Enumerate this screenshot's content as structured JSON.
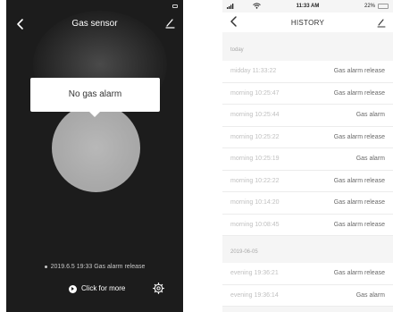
{
  "left": {
    "title": "Gas sensor",
    "status_popup": "No gas alarm",
    "last_event": "2019.6.5 19:33 Gas alarm release",
    "more_label": "Click for more",
    "icons": {
      "back": "chevron-left-icon",
      "edit": "pencil-icon",
      "more": "play-circle-icon",
      "settings": "gear-icon"
    }
  },
  "right": {
    "status_bar": {
      "time": "11:33 AM",
      "battery": "22%"
    },
    "title": "HISTORY",
    "sections": [
      {
        "label": "today",
        "rows": [
          {
            "time": "midday  11:33:22",
            "event": "Gas alarm release"
          },
          {
            "time": "morning  10:25:47",
            "event": "Gas alarm release"
          },
          {
            "time": "morning  10:25:44",
            "event": "Gas alarm"
          },
          {
            "time": "morning  10:25:22",
            "event": "Gas alarm release"
          },
          {
            "time": "morning  10:25:19",
            "event": "Gas alarm"
          },
          {
            "time": "morning  10:22:22",
            "event": "Gas alarm release"
          },
          {
            "time": "morning  10:14:20",
            "event": "Gas alarm release"
          },
          {
            "time": "morning  10:08:45",
            "event": "Gas alarm release"
          }
        ]
      },
      {
        "label": "2019-06-05",
        "rows": [
          {
            "time": "evening  19:36:21",
            "event": "Gas alarm release"
          },
          {
            "time": "evening  19:36:14",
            "event": "Gas alarm"
          }
        ]
      }
    ]
  },
  "colors": {
    "left_background": "#1c1c1c",
    "sensor_circle": "#a9a9a9",
    "right_background": "#f5f5f5"
  }
}
